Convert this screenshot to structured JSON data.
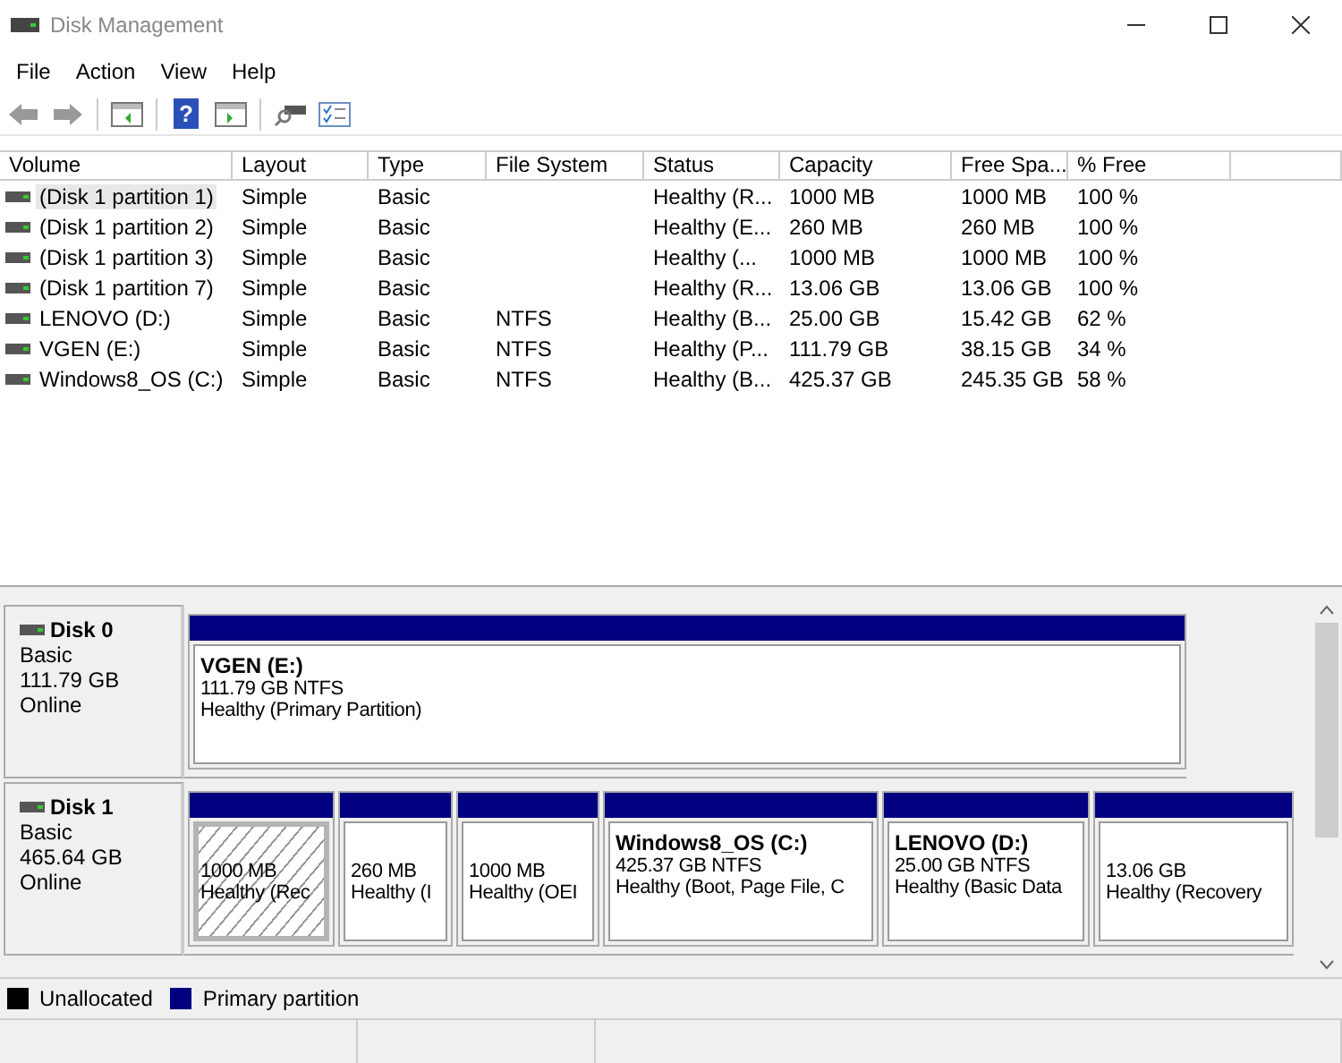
{
  "window": {
    "title": "Disk Management"
  },
  "menu": [
    "File",
    "Action",
    "View",
    "Help"
  ],
  "toolbar": {
    "help": "?"
  },
  "table": {
    "columns": [
      "Volume",
      "Layout",
      "Type",
      "File System",
      "Status",
      "Capacity",
      "Free Spa...",
      "% Free"
    ],
    "rows": [
      {
        "selected": true,
        "cells": [
          "(Disk 1 partition 1)",
          "Simple",
          "Basic",
          "",
          "Healthy (R...",
          "1000 MB",
          "1000 MB",
          "100 %"
        ]
      },
      {
        "selected": false,
        "cells": [
          "(Disk 1 partition 2)",
          "Simple",
          "Basic",
          "",
          "Healthy (E...",
          "260 MB",
          "260 MB",
          "100 %"
        ]
      },
      {
        "selected": false,
        "cells": [
          "(Disk 1 partition 3)",
          "Simple",
          "Basic",
          "",
          "Healthy (...",
          "1000 MB",
          "1000 MB",
          "100 %"
        ]
      },
      {
        "selected": false,
        "cells": [
          "(Disk 1 partition 7)",
          "Simple",
          "Basic",
          "",
          "Healthy (R...",
          "13.06 GB",
          "13.06 GB",
          "100 %"
        ]
      },
      {
        "selected": false,
        "cells": [
          "LENOVO (D:)",
          "Simple",
          "Basic",
          "NTFS",
          "Healthy (B...",
          "25.00 GB",
          "15.42 GB",
          "62 %"
        ]
      },
      {
        "selected": false,
        "cells": [
          "VGEN (E:)",
          "Simple",
          "Basic",
          "NTFS",
          "Healthy (P...",
          "111.79 GB",
          "38.15 GB",
          "34 %"
        ]
      },
      {
        "selected": false,
        "cells": [
          "Windows8_OS (C:)",
          "Simple",
          "Basic",
          "NTFS",
          "Healthy (B...",
          "425.37 GB",
          "245.35 GB",
          "58 %"
        ]
      }
    ]
  },
  "disks": [
    {
      "name": "Disk 0",
      "type": "Basic",
      "size": "111.79 GB",
      "state": "Online",
      "partitions": [
        {
          "selected": false,
          "label": "VGEN  (E:)",
          "size": "111.79 GB NTFS",
          "status": "Healthy (Primary Partition)"
        }
      ]
    },
    {
      "name": "Disk 1",
      "type": "Basic",
      "size": "465.64 GB",
      "state": "Online",
      "partitions": [
        {
          "selected": true,
          "size": "1000 MB",
          "status": "Healthy (Rec"
        },
        {
          "selected": false,
          "size": "260 MB",
          "status": "Healthy (I"
        },
        {
          "selected": false,
          "size": "1000 MB",
          "status": "Healthy (OEI"
        },
        {
          "selected": false,
          "label": "Windows8_OS  (C:)",
          "size": "425.37 GB NTFS",
          "status": "Healthy (Boot, Page File, C"
        },
        {
          "selected": false,
          "label": "LENOVO  (D:)",
          "size": "25.00 GB NTFS",
          "status": "Healthy (Basic Data"
        },
        {
          "selected": false,
          "size": "13.06 GB",
          "status": "Healthy (Recovery"
        }
      ]
    }
  ],
  "legend": [
    {
      "label": "Unallocated",
      "color": "#000000"
    },
    {
      "label": "Primary partition",
      "color": "#000080"
    }
  ]
}
